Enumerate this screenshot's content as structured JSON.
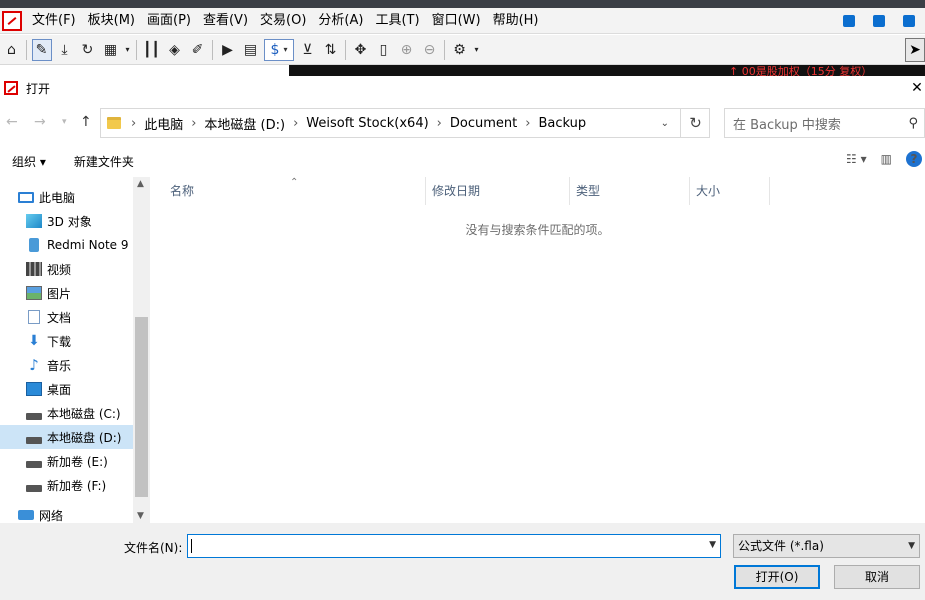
{
  "app": {
    "menu": [
      "文件(F)",
      "板块(M)",
      "画面(P)",
      "查看(V)",
      "交易(O)",
      "分析(A)",
      "工具(T)",
      "窗口(W)",
      "帮助(H)"
    ],
    "toolbar_dollar": "$",
    "strip_text": "↑ 00是股加权（15分   复权）"
  },
  "dialog": {
    "title": "打开",
    "breadcrumb": [
      "此电脑",
      "本地磁盘 (D:)",
      "Weisoft Stock(x64)",
      "Document",
      "Backup"
    ],
    "search_placeholder": "在 Backup 中搜索",
    "commands": {
      "organize": "组织 ▾",
      "new_folder": "新建文件夹"
    },
    "nav_items": [
      {
        "label": "此电脑",
        "icon": "pc-icon"
      },
      {
        "label": "3D 对象",
        "icon": "3d-objects-icon"
      },
      {
        "label": "Redmi Note 9",
        "icon": "phone-icon"
      },
      {
        "label": "视频",
        "icon": "video-icon"
      },
      {
        "label": "图片",
        "icon": "pictures-icon"
      },
      {
        "label": "文档",
        "icon": "documents-icon"
      },
      {
        "label": "下载",
        "icon": "download-icon"
      },
      {
        "label": "音乐",
        "icon": "music-icon"
      },
      {
        "label": "桌面",
        "icon": "desktop-icon"
      },
      {
        "label": "本地磁盘 (C:)",
        "icon": "drive-icon"
      },
      {
        "label": "本地磁盘 (D:)",
        "icon": "drive-icon",
        "selected": true
      },
      {
        "label": "新加卷 (E:)",
        "icon": "drive-icon"
      },
      {
        "label": "新加卷 (F:)",
        "icon": "drive-icon"
      },
      {
        "label": "网络",
        "icon": "network-icon"
      }
    ],
    "columns": [
      "名称",
      "修改日期",
      "类型",
      "大小"
    ],
    "empty_message": "没有与搜索条件匹配的项。",
    "filename_label": "文件名(N):",
    "filename_value": "",
    "filetype": "公式文件 (*.fla)",
    "open_button": "打开(O)",
    "cancel_button": "取消"
  },
  "colors": {
    "accent": "#0078d7",
    "selection": "#cce4f7"
  }
}
